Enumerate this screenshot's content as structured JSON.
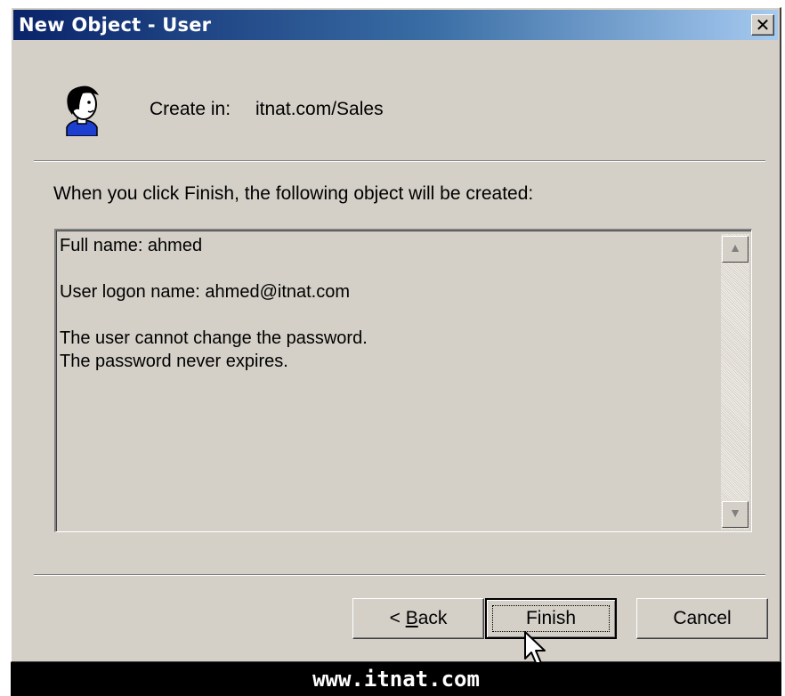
{
  "window": {
    "title": "New Object - User",
    "close_glyph": "✕"
  },
  "header": {
    "create_in_label": "Create in:",
    "create_in_value": "itnat.com/Sales",
    "icon": "user-icon"
  },
  "intro_text": "When you click Finish, the following object will be created:",
  "summary": {
    "lines": [
      "Full name: ahmed",
      "",
      "User logon name: ahmed@itnat.com",
      "",
      "The user cannot change the password.",
      "The password never expires."
    ]
  },
  "buttons": {
    "back_prefix": "< ",
    "back_mnemonic": "B",
    "back_rest": "ack",
    "finish": "Finish",
    "cancel": "Cancel"
  },
  "watermark": "www.itnat.com",
  "colors": {
    "titlebar_start": "#0a246a",
    "titlebar_end": "#a6caf0",
    "dialog_face": "#d4d0c8"
  }
}
